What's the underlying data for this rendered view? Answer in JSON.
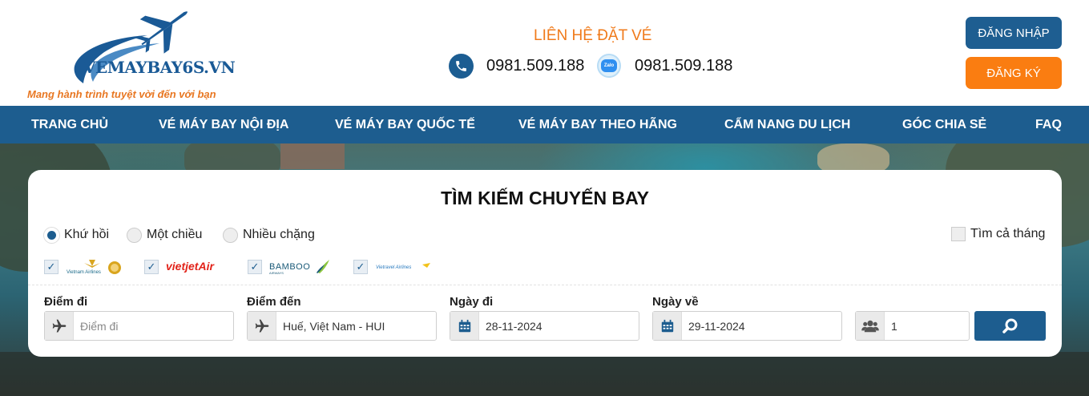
{
  "header": {
    "logo_text": "VEMAYBAY6S.VN",
    "tagline": "Mang hành trình tuyệt vời đến với bạn",
    "contact_title": "LIÊN HỆ ĐẶT VÉ",
    "phone_1": "0981.509.188",
    "phone_2": "0981.509.188",
    "zalo_label": "Zalo",
    "login_label": "ĐĂNG NHẬP",
    "register_label": "ĐĂNG KÝ"
  },
  "nav": {
    "items": [
      {
        "label": "TRANG CHỦ"
      },
      {
        "label": "VÉ MÁY BAY NỘI ĐỊA"
      },
      {
        "label": "VÉ MÁY BAY QUỐC TẾ"
      },
      {
        "label": "VÉ MÁY BAY THEO HÃNG"
      },
      {
        "label": "CẨM NANG DU LỊCH"
      },
      {
        "label": "GÓC CHIA SẺ"
      },
      {
        "label": "FAQ"
      }
    ]
  },
  "search": {
    "title": "TÌM KIẾM CHUYẾN BAY",
    "trip_types": [
      {
        "label": "Khứ hồi",
        "selected": true
      },
      {
        "label": "Một chiều",
        "selected": false
      },
      {
        "label": "Nhiều chặng",
        "selected": false
      }
    ],
    "whole_month_label": "Tìm cả tháng",
    "airlines": [
      {
        "name": "Vietnam Airlines",
        "checked": true
      },
      {
        "name": "vietjetAir",
        "checked": true
      },
      {
        "name": "BAMBOO",
        "checked": true
      },
      {
        "name": "Vietravel Airlines",
        "checked": true
      }
    ],
    "from_label": "Điểm đi",
    "from_placeholder": "Điểm đi",
    "to_label": "Điểm đến",
    "to_value": "Huế, Việt Nam - HUI",
    "depart_label": "Ngày đi",
    "depart_value": "28-11-2024",
    "return_label": "Ngày về",
    "return_value": "29-11-2024",
    "passengers_value": "1"
  },
  "colors": {
    "brand_blue": "#1d5d8f",
    "brand_orange": "#fa7d11"
  }
}
